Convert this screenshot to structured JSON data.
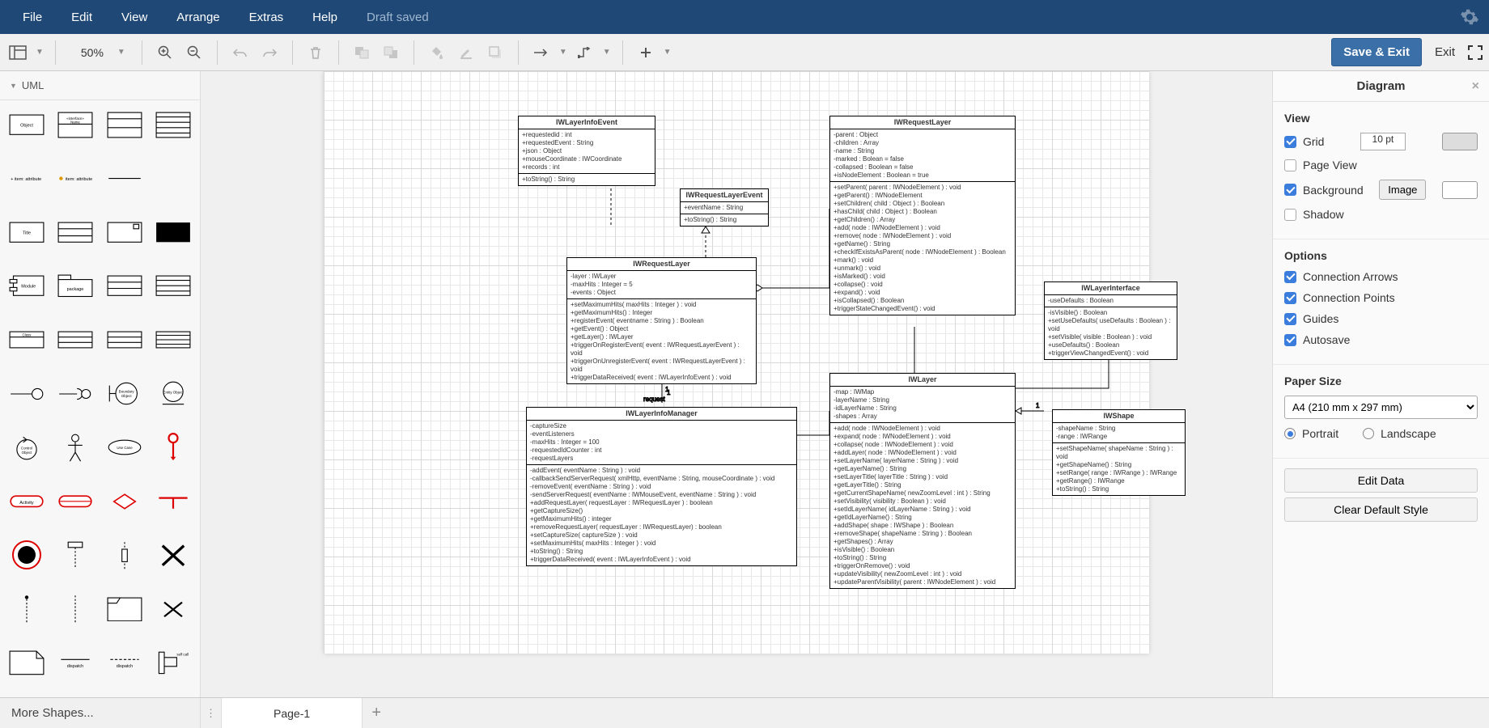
{
  "menubar": {
    "items": [
      "File",
      "Edit",
      "View",
      "Arrange",
      "Extras",
      "Help"
    ],
    "status": "Draft saved"
  },
  "toolbar": {
    "zoom": "50%",
    "save_exit": "Save & Exit",
    "exit": "Exit"
  },
  "shapes_panel": {
    "title": "UML",
    "more_shapes": "More Shapes..."
  },
  "tabs": {
    "page1": "Page-1"
  },
  "right_panel": {
    "title": "Diagram",
    "view_h": "View",
    "grid": "Grid",
    "grid_value": "10 pt",
    "page_view": "Page View",
    "background": "Background",
    "image_btn": "Image",
    "shadow": "Shadow",
    "options_h": "Options",
    "conn_arrows": "Connection Arrows",
    "conn_points": "Connection Points",
    "guides": "Guides",
    "autosave": "Autosave",
    "paper_h": "Paper Size",
    "paper_size": "A4 (210 mm x 297 mm)",
    "portrait": "Portrait",
    "landscape": "Landscape",
    "edit_data": "Edit Data",
    "clear_style": "Clear Default Style"
  },
  "uml_classes": {
    "IWLayerInfoEvent": {
      "title": "IWLayerInfoEvent",
      "attrs": "+requestedid : int\n+requestedEvent : String\n+json : Object\n+mouseCoordinate : IWCoordinate\n+records : int",
      "ops": "+toString() : String"
    },
    "IWRequestLayerEvent": {
      "title": "IWRequestLayerEvent",
      "attrs": "+eventName : String",
      "ops": "+toString() : String"
    },
    "IWRequestLayer_top": {
      "title": "IWRequestLayer",
      "attrs": "-parent : Object\n-children : Array\n-name : String\n-marked : Bolean = false\n-collapsed : Boolean = false\n+isNodeElement : Boolean = true",
      "ops": "+setParent( parent : IWNodeElement ) : void\n+getParent() : IWNodeElement\n+setChildren( child : Object ) : Boolean\n+hasChild( child : Object ) : Boolean\n+getChildren() : Array\n+add( node : IWNodeElement ) : void\n+remove( node : IWNodeElement ) : void\n+getName() : String\n+checkIfExistsAsParent( node : IWNodeElement ) : Boolean\n+mark() : void\n+unmark() : void\n+isMarked() : void\n+collapse() : void\n+expand() : void\n+isCollapsed() : Boolean\n+triggerStateChangedEvent() : void"
    },
    "IWRequestLayer_mid": {
      "title": "IWRequestLayer",
      "attrs": "-layer : IWLayer\n-maxHits : Integer = 5\n-events : Object",
      "ops": "+setMaximumHits( maxHits : Integer ) : void\n+getMaximumHits() : Integer\n+registerEvent( eventname : String ) : Boolean\n+getEvent() : Object\n+getLayer() : IWLayer\n+triggerOnRegisterEvent( event : IWRequestLayerEvent ) : void\n+triggerOnUnregisterEvent( event : IWRequestLayerEvent ) : void\n+triggerDataReceived( event : IWLayerInfoEvent ) : void"
    },
    "IWLayerInterface": {
      "title": "IWLayerInterface",
      "attrs": "-useDefaults : Boolean",
      "ops": "-isVisible() : Boolean\n+setUseDefaults( useDefaults : Boolean ) : void\n+setVisible( visible : Boolean ) : void\n+useDefaults() : Boolean\n+triggerViewChangedEvent() : void"
    },
    "IWLayer": {
      "title": "IWLayer",
      "attrs": "-map : IWMap\n-layerName : String\n-idLayerName : String\n-shapes : Array",
      "ops": "+add( node : IWNodeElement ) : void\n+expand( node : IWNodeElement ) : void\n+collapse( node : IWNodeElement ) : void\n+addLayer( node : IWNodeElement ) : void\n+setLayerName( layerName : String ) : void\n+getLayerName() : String\n+setLayerTitle( layerTitle : String ) : void\n+getLayerTitle() : String\n+getCurrentShapeName( newZoomLevel : int ) : String\n+setVisibility( visibility : Boolean ) : void\n+setIdLayerName( idLayerName : String ) : void\n+getIdLayerName() : String\n+addShape( shape : IWShape ) : Boolean\n+removeShape( shapeName : String ) : Boolean\n+getShapes() : Array\n+isVisible() : Boolean\n+toString() : String\n+triggerOnRemove() : void\n+updateVisibility( newZoomLevel : int ) : void\n+updateParentVisibility( parent : IWNodeElement ) : void"
    },
    "IWShape": {
      "title": "IWShape",
      "attrs": "-shapeName : String\n-range : IWRange",
      "ops": "+setShapeName( shapeName : String ) : void\n+getShapeName() : String\n+setRange( range : IWRange ) : IWRange\n+getRange() : IWRange\n+toString() : String"
    },
    "IWLayerInfoManager": {
      "title": "IWLayerInfoManager",
      "attrs": "-captureSize\n-eventListeners\n-maxHits : Integer = 100\n-requestedIdCounter : int\n-requestLayers",
      "ops": "-addEvent( eventName : String ) : void\n-callbackSendServerRequest( xmlHttp, eventName : String, mouseCoordinate ) : void\n-removeEvent( eventName : String ) : void\n-sendServerRequest( eventName : IWMouseEvent, eventName : String ) : void\n+addRequestLayer( requestLayer : IWRequestLayer ) : boolean\n+getCaptureSize()\n+getMaximumHits() : integer\n+removeRequestLayer( requestLayer : IWRequestLayer) : boolean\n+setCaptureSize( captureSize ) : void\n+setMaximumHits( maxHits : Integer ) : void\n+toString() : String\n+triggerDataReceived( event : IWLayerInfoEvent ) : void"
    }
  },
  "canvas_labels": {
    "request": "request",
    "one1": "1",
    "one2": "1",
    "one3": "1"
  }
}
